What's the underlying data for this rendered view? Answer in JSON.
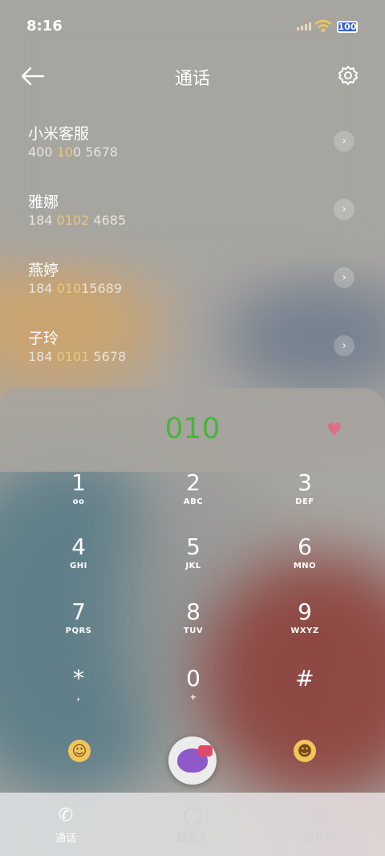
{
  "status": {
    "time": "8:16",
    "battery": "100"
  },
  "header": {
    "title": "通话"
  },
  "contacts": [
    {
      "name": "小米客服",
      "num_pre": "400 ",
      "num_hl": "10",
      "num_post": "0 5678"
    },
    {
      "name": "雅娜",
      "num_pre": "184 ",
      "num_hl": "0102",
      "num_post": " 4685"
    },
    {
      "name": "燕婷",
      "num_pre": "184 ",
      "num_hl": "010",
      "num_post": "15689"
    },
    {
      "name": "子玲",
      "num_pre": "184 ",
      "num_hl": "0101",
      "num_post": " 5678"
    }
  ],
  "dialer": {
    "input": "010",
    "keys": [
      {
        "d": "1",
        "l": "oo"
      },
      {
        "d": "2",
        "l": "ABC"
      },
      {
        "d": "3",
        "l": "DEF"
      },
      {
        "d": "4",
        "l": "GHI"
      },
      {
        "d": "5",
        "l": "JKL"
      },
      {
        "d": "6",
        "l": "MNO"
      },
      {
        "d": "7",
        "l": "PQRS"
      },
      {
        "d": "8",
        "l": "TUV"
      },
      {
        "d": "9",
        "l": "WXYZ"
      },
      {
        "d": "*",
        "l": ","
      },
      {
        "d": "0",
        "l": "+"
      },
      {
        "d": "#",
        "l": ""
      }
    ]
  },
  "tabs": [
    {
      "label": "通话",
      "icon": "phone-icon",
      "active": true
    },
    {
      "label": "联系人",
      "icon": "contact-icon",
      "active": false
    },
    {
      "label": "营业厅",
      "icon": "store-icon",
      "active": false
    }
  ],
  "colors": {
    "accent_digits": "#4ab43e",
    "highlight": "#e8c97a",
    "battery": "#2f62d6"
  }
}
